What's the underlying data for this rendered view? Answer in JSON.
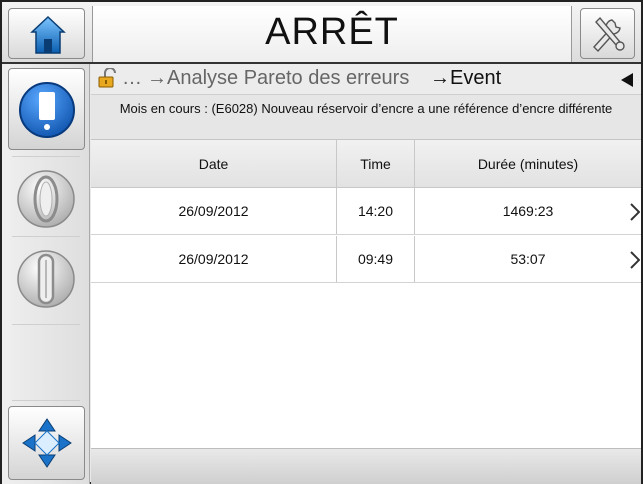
{
  "header": {
    "title": "ARRÊT",
    "home_icon": "home-icon",
    "tools_icon": "tools-icon"
  },
  "sidebar": {
    "items": [
      {
        "name": "ink-system",
        "icon": "ink-cartridge-icon",
        "active": true
      },
      {
        "name": "jet-start",
        "icon": "jet-open-icon",
        "active": false
      },
      {
        "name": "jet-stop",
        "icon": "jet-closed-icon",
        "active": false
      },
      {
        "name": "navigation",
        "icon": "directional-pad-icon",
        "active": false
      }
    ]
  },
  "breadcrumb": {
    "lock_icon": "unlocked-padlock-icon",
    "ellipsis": "…",
    "items": [
      "→Analyse Pareto des erreurs",
      "→Event"
    ],
    "back_icon": "back-arrow-icon"
  },
  "subtitle": "Mois en cours : (E6028) Nouveau réservoir d’encre a une référence d’encre différente",
  "table": {
    "columns": [
      "Date",
      "Time",
      "Durée (minutes)"
    ],
    "rows": [
      {
        "date": "26/09/2012",
        "time": "14:20",
        "duration": "1469:23"
      },
      {
        "date": "26/09/2012",
        "time": "09:49",
        "duration": "53:07"
      }
    ]
  },
  "colors": {
    "accent_blue": "#1a73c9",
    "frame": "#222222"
  }
}
